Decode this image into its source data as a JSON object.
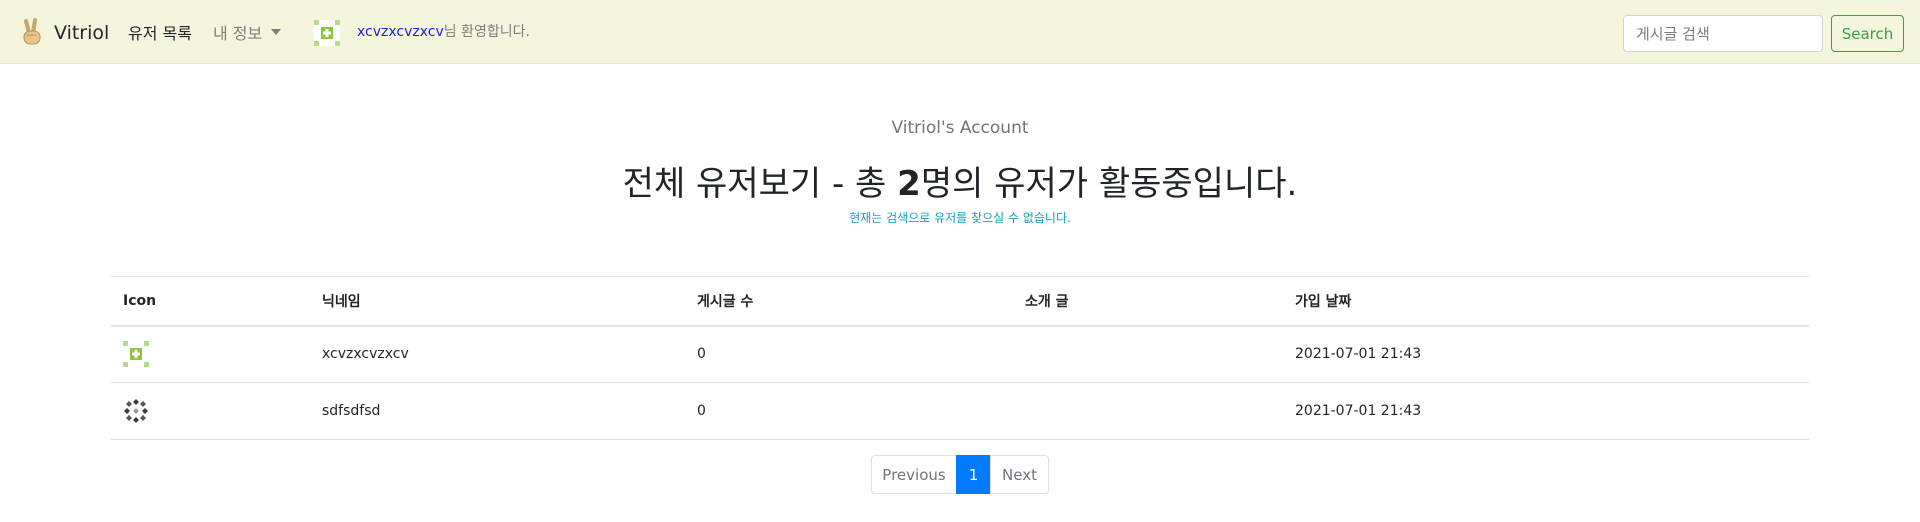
{
  "navbar": {
    "brand": "Vitriol",
    "users_link": "유저 목록",
    "my_info": "내 정보",
    "welcome_name": "xcvzxcvzxcv",
    "welcome_suffix": "님 환영합니다.",
    "search_placeholder": "게시글 검색",
    "search_button": "Search"
  },
  "header": {
    "subtitle": "Vitriol's Account",
    "title_prefix": "전체 유저보기 - 총 ",
    "title_count": "2",
    "title_suffix": "명의 유저가 활동중입니다.",
    "notice": "현재는 검색으로 유저를 찾으실 수 없습니다."
  },
  "table": {
    "columns": [
      "Icon",
      "닉네임",
      "게시글 수",
      "소개 글",
      "가입 날짜"
    ],
    "rows": [
      {
        "icon": "identicon-green-icon",
        "nickname": "xcvzxcvzxcv",
        "posts": "0",
        "intro": "",
        "joined": "2021-07-01 21:43"
      },
      {
        "icon": "identicon-dark-icon",
        "nickname": "sdfsdfsd",
        "posts": "0",
        "intro": "",
        "joined": "2021-07-01 21:43"
      }
    ]
  },
  "pagination": {
    "previous": "Previous",
    "current": "1",
    "next": "Next"
  },
  "colors": {
    "navbar_bg": "#f5f5dc",
    "accent_green": "#28a745",
    "active_page": "#007bff",
    "notice": "#17a2b8",
    "welcome_name": "#2020c8"
  }
}
